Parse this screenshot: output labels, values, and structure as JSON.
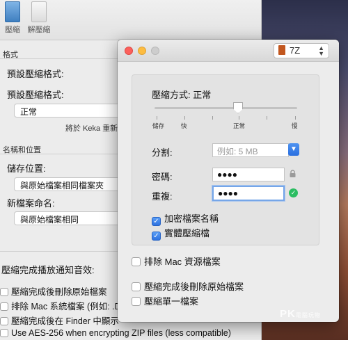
{
  "toolbar": {
    "compress_label": "壓縮",
    "extract_label": "解壓縮"
  },
  "back": {
    "format_section": "格式",
    "default_format_1": "預設壓縮格式:",
    "default_format_2": "預設壓縮格式:",
    "level_value": "正常",
    "keka_note": "將於 Keka 重新",
    "name_section": "名稱和位置",
    "save_location_label": "儲存位置:",
    "save_location_value": "與原始檔案相同檔案夾",
    "new_name_label": "新檔案命名:",
    "new_name_value": "與原始檔案相同",
    "sound_label": "壓縮完成播放通知音效:",
    "checks": [
      "壓縮完成後刪除原始檔案",
      "排除 Mac 系統檔案 (例如: .D",
      "壓縮完成後在 Finder 中顯示",
      "Use AES-256 when encrypting ZIP files (less compatible)"
    ]
  },
  "dialog": {
    "format_value": "7Z",
    "method_label": "壓縮方式: 正常",
    "slider_ticks": [
      "儲存",
      "快",
      "正常",
      "慢"
    ],
    "slider_level": 0.55,
    "split_label": "分割:",
    "split_placeholder": "例如: 5 MB",
    "password_label": "密碼:",
    "password_value": "●●●●",
    "repeat_label": "重複:",
    "repeat_value": "●●●●",
    "encrypt_names_label": "加密檔案名稱",
    "solid_label": "實體壓縮檔",
    "exclude_mac_label": "排除 Mac 資源檔案",
    "delete_after_label": "壓縮完成後刪除原始檔案",
    "single_file_label": "壓縮單一檔案"
  },
  "watermark": {
    "brand": "PK",
    "sub": "電腦玩物"
  },
  "colors": {
    "accent_blue": "#2e72e0",
    "ok_green": "#2bbd62",
    "close_red": "#fc605c"
  }
}
